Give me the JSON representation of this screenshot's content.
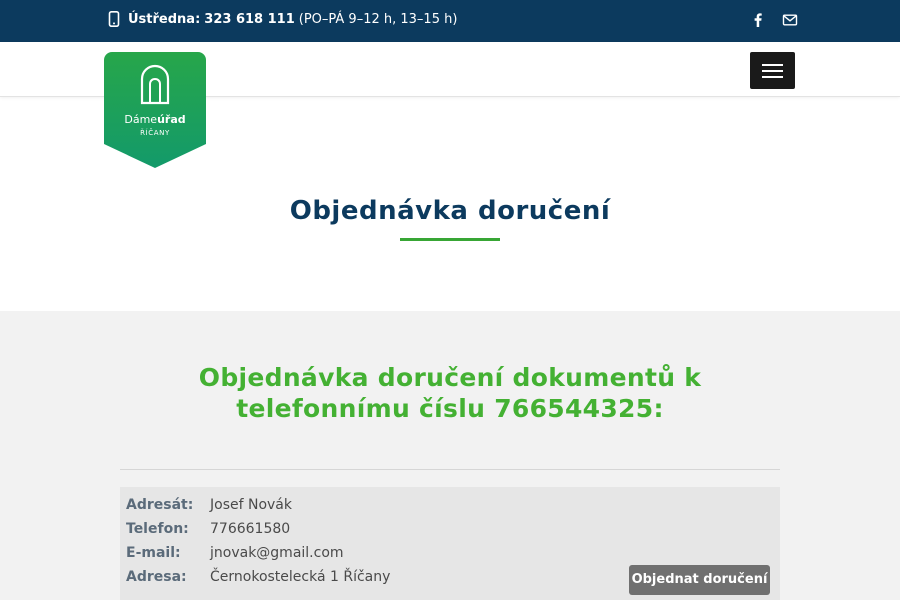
{
  "topbar": {
    "phone_label": "Ústředna:",
    "phone_number": "323 618 111",
    "hours": "(PO–PÁ 9–12 h, 13–15 h)",
    "icons": [
      "mobile-phone-icon",
      "facebook-icon",
      "envelope-icon"
    ]
  },
  "logo": {
    "brand_prefix": "Dáme",
    "brand_bold": "úřad",
    "city": "ŘÍČANY"
  },
  "page": {
    "title": "Objednávka doručení"
  },
  "order": {
    "heading": "Objednávka doručení dokumentů k telefonnímu číslu 766544325:",
    "rows": [
      {
        "label": "Adresát:",
        "value": "Josef Novák"
      },
      {
        "label": "Telefon:",
        "value": "776661580"
      },
      {
        "label": "E-mail:",
        "value": "jnovak@gmail.com"
      },
      {
        "label": "Adresa:",
        "value": "Černokostelecká 1 Říčany"
      }
    ],
    "button_label": "Objednat doručení"
  },
  "colors": {
    "topbar": "#0c3a5e",
    "accent_green": "#44b133",
    "logo_green": "#1fa049",
    "title_blue": "#0c3a5e",
    "button_grey": "#707070"
  }
}
